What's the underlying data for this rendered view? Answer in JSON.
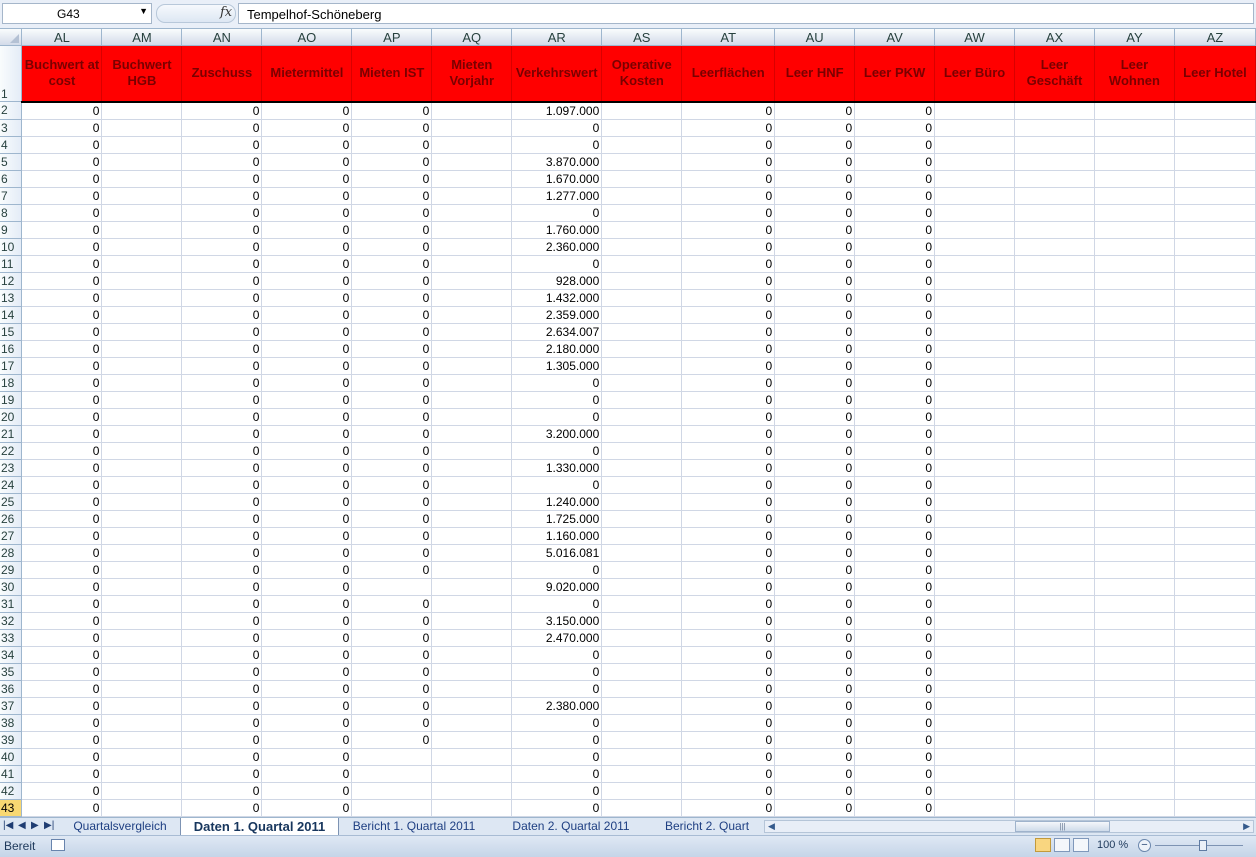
{
  "formula_bar": {
    "name_box": "G43",
    "fx_icon": "function-icon",
    "formula": "Tempelhof-Schöneberg"
  },
  "columns": [
    "AL",
    "AM",
    "AN",
    "AO",
    "AP",
    "AQ",
    "AR",
    "AS",
    "AT",
    "AU",
    "AV",
    "AW",
    "AX",
    "AY",
    "AZ"
  ],
  "header_row_num": "1",
  "headers": [
    "Buchwert at cost",
    "Buchwert HGB",
    "Zuschuss",
    "Mietermittel",
    "Mieten IST",
    "Mieten Vorjahr",
    "Verkehrswert",
    "Operative Kosten",
    "Leerflächen",
    "Leer HNF",
    "Leer PKW",
    "Leer Büro",
    "Leer Geschäft",
    "Leer Wohnen",
    "Leer Hotel"
  ],
  "rows": [
    {
      "n": "2",
      "v": [
        "0",
        "",
        "0",
        "0",
        "0",
        "",
        "1.097.000",
        "",
        "0",
        "0",
        "0",
        "",
        "",
        "",
        ""
      ]
    },
    {
      "n": "3",
      "v": [
        "0",
        "",
        "0",
        "0",
        "0",
        "",
        "0",
        "",
        "0",
        "0",
        "0",
        "",
        "",
        "",
        ""
      ]
    },
    {
      "n": "4",
      "v": [
        "0",
        "",
        "0",
        "0",
        "0",
        "",
        "0",
        "",
        "0",
        "0",
        "0",
        "",
        "",
        "",
        ""
      ]
    },
    {
      "n": "5",
      "v": [
        "0",
        "",
        "0",
        "0",
        "0",
        "",
        "3.870.000",
        "",
        "0",
        "0",
        "0",
        "",
        "",
        "",
        ""
      ]
    },
    {
      "n": "6",
      "v": [
        "0",
        "",
        "0",
        "0",
        "0",
        "",
        "1.670.000",
        "",
        "0",
        "0",
        "0",
        "",
        "",
        "",
        ""
      ]
    },
    {
      "n": "7",
      "v": [
        "0",
        "",
        "0",
        "0",
        "0",
        "",
        "1.277.000",
        "",
        "0",
        "0",
        "0",
        "",
        "",
        "",
        ""
      ]
    },
    {
      "n": "8",
      "v": [
        "0",
        "",
        "0",
        "0",
        "0",
        "",
        "0",
        "",
        "0",
        "0",
        "0",
        "",
        "",
        "",
        ""
      ]
    },
    {
      "n": "9",
      "v": [
        "0",
        "",
        "0",
        "0",
        "0",
        "",
        "1.760.000",
        "",
        "0",
        "0",
        "0",
        "",
        "",
        "",
        ""
      ]
    },
    {
      "n": "10",
      "v": [
        "0",
        "",
        "0",
        "0",
        "0",
        "",
        "2.360.000",
        "",
        "0",
        "0",
        "0",
        "",
        "",
        "",
        ""
      ]
    },
    {
      "n": "11",
      "v": [
        "0",
        "",
        "0",
        "0",
        "0",
        "",
        "0",
        "",
        "0",
        "0",
        "0",
        "",
        "",
        "",
        ""
      ]
    },
    {
      "n": "12",
      "v": [
        "0",
        "",
        "0",
        "0",
        "0",
        "",
        "928.000",
        "",
        "0",
        "0",
        "0",
        "",
        "",
        "",
        ""
      ]
    },
    {
      "n": "13",
      "v": [
        "0",
        "",
        "0",
        "0",
        "0",
        "",
        "1.432.000",
        "",
        "0",
        "0",
        "0",
        "",
        "",
        "",
        ""
      ]
    },
    {
      "n": "14",
      "v": [
        "0",
        "",
        "0",
        "0",
        "0",
        "",
        "2.359.000",
        "",
        "0",
        "0",
        "0",
        "",
        "",
        "",
        ""
      ]
    },
    {
      "n": "15",
      "v": [
        "0",
        "",
        "0",
        "0",
        "0",
        "",
        "2.634.007",
        "",
        "0",
        "0",
        "0",
        "",
        "",
        "",
        ""
      ]
    },
    {
      "n": "16",
      "v": [
        "0",
        "",
        "0",
        "0",
        "0",
        "",
        "2.180.000",
        "",
        "0",
        "0",
        "0",
        "",
        "",
        "",
        ""
      ]
    },
    {
      "n": "17",
      "v": [
        "0",
        "",
        "0",
        "0",
        "0",
        "",
        "1.305.000",
        "",
        "0",
        "0",
        "0",
        "",
        "",
        "",
        ""
      ]
    },
    {
      "n": "18",
      "v": [
        "0",
        "",
        "0",
        "0",
        "0",
        "",
        "0",
        "",
        "0",
        "0",
        "0",
        "",
        "",
        "",
        ""
      ]
    },
    {
      "n": "19",
      "v": [
        "0",
        "",
        "0",
        "0",
        "0",
        "",
        "0",
        "",
        "0",
        "0",
        "0",
        "",
        "",
        "",
        ""
      ]
    },
    {
      "n": "20",
      "v": [
        "0",
        "",
        "0",
        "0",
        "0",
        "",
        "0",
        "",
        "0",
        "0",
        "0",
        "",
        "",
        "",
        ""
      ]
    },
    {
      "n": "21",
      "v": [
        "0",
        "",
        "0",
        "0",
        "0",
        "",
        "3.200.000",
        "",
        "0",
        "0",
        "0",
        "",
        "",
        "",
        ""
      ]
    },
    {
      "n": "22",
      "v": [
        "0",
        "",
        "0",
        "0",
        "0",
        "",
        "0",
        "",
        "0",
        "0",
        "0",
        "",
        "",
        "",
        ""
      ]
    },
    {
      "n": "23",
      "v": [
        "0",
        "",
        "0",
        "0",
        "0",
        "",
        "1.330.000",
        "",
        "0",
        "0",
        "0",
        "",
        "",
        "",
        ""
      ]
    },
    {
      "n": "24",
      "v": [
        "0",
        "",
        "0",
        "0",
        "0",
        "",
        "0",
        "",
        "0",
        "0",
        "0",
        "",
        "",
        "",
        ""
      ]
    },
    {
      "n": "25",
      "v": [
        "0",
        "",
        "0",
        "0",
        "0",
        "",
        "1.240.000",
        "",
        "0",
        "0",
        "0",
        "",
        "",
        "",
        ""
      ]
    },
    {
      "n": "26",
      "v": [
        "0",
        "",
        "0",
        "0",
        "0",
        "",
        "1.725.000",
        "",
        "0",
        "0",
        "0",
        "",
        "",
        "",
        ""
      ]
    },
    {
      "n": "27",
      "v": [
        "0",
        "",
        "0",
        "0",
        "0",
        "",
        "1.160.000",
        "",
        "0",
        "0",
        "0",
        "",
        "",
        "",
        ""
      ]
    },
    {
      "n": "28",
      "v": [
        "0",
        "",
        "0",
        "0",
        "0",
        "",
        "5.016.081",
        "",
        "0",
        "0",
        "0",
        "",
        "",
        "",
        ""
      ]
    },
    {
      "n": "29",
      "v": [
        "0",
        "",
        "0",
        "0",
        "0",
        "",
        "0",
        "",
        "0",
        "0",
        "0",
        "",
        "",
        "",
        ""
      ]
    },
    {
      "n": "30",
      "v": [
        "0",
        "",
        "0",
        "0",
        "",
        "",
        "9.020.000",
        "",
        "0",
        "0",
        "0",
        "",
        "",
        "",
        ""
      ]
    },
    {
      "n": "31",
      "v": [
        "0",
        "",
        "0",
        "0",
        "0",
        "",
        "0",
        "",
        "0",
        "0",
        "0",
        "",
        "",
        "",
        ""
      ]
    },
    {
      "n": "32",
      "v": [
        "0",
        "",
        "0",
        "0",
        "0",
        "",
        "3.150.000",
        "",
        "0",
        "0",
        "0",
        "",
        "",
        "",
        ""
      ]
    },
    {
      "n": "33",
      "v": [
        "0",
        "",
        "0",
        "0",
        "0",
        "",
        "2.470.000",
        "",
        "0",
        "0",
        "0",
        "",
        "",
        "",
        ""
      ]
    },
    {
      "n": "34",
      "v": [
        "0",
        "",
        "0",
        "0",
        "0",
        "",
        "0",
        "",
        "0",
        "0",
        "0",
        "",
        "",
        "",
        ""
      ]
    },
    {
      "n": "35",
      "v": [
        "0",
        "",
        "0",
        "0",
        "0",
        "",
        "0",
        "",
        "0",
        "0",
        "0",
        "",
        "",
        "",
        ""
      ]
    },
    {
      "n": "36",
      "v": [
        "0",
        "",
        "0",
        "0",
        "0",
        "",
        "0",
        "",
        "0",
        "0",
        "0",
        "",
        "",
        "",
        ""
      ]
    },
    {
      "n": "37",
      "v": [
        "0",
        "",
        "0",
        "0",
        "0",
        "",
        "2.380.000",
        "",
        "0",
        "0",
        "0",
        "",
        "",
        "",
        ""
      ]
    },
    {
      "n": "38",
      "v": [
        "0",
        "",
        "0",
        "0",
        "0",
        "",
        "0",
        "",
        "0",
        "0",
        "0",
        "",
        "",
        "",
        ""
      ]
    },
    {
      "n": "39",
      "v": [
        "0",
        "",
        "0",
        "0",
        "0",
        "",
        "0",
        "",
        "0",
        "0",
        "0",
        "",
        "",
        "",
        ""
      ]
    },
    {
      "n": "40",
      "v": [
        "0",
        "",
        "0",
        "0",
        "",
        "",
        "0",
        "",
        "0",
        "0",
        "0",
        "",
        "",
        "",
        ""
      ]
    },
    {
      "n": "41",
      "v": [
        "0",
        "",
        "0",
        "0",
        "",
        "",
        "0",
        "",
        "0",
        "0",
        "0",
        "",
        "",
        "",
        ""
      ]
    },
    {
      "n": "42",
      "v": [
        "0",
        "",
        "0",
        "0",
        "",
        "",
        "0",
        "",
        "0",
        "0",
        "0",
        "",
        "",
        "",
        ""
      ]
    },
    {
      "n": "43",
      "v": [
        "0",
        "",
        "0",
        "0",
        "",
        "",
        "0",
        "",
        "0",
        "0",
        "0",
        "",
        "",
        "",
        ""
      ]
    }
  ],
  "selected_row": "43",
  "sheet_tabs": [
    {
      "label": "Quartalsvergleich",
      "active": false
    },
    {
      "label": "Daten 1. Quartal 2011",
      "active": true
    },
    {
      "label": "Bericht 1. Quartal 2011",
      "active": false
    },
    {
      "label": "Daten 2. Quartal 2011",
      "active": false
    },
    {
      "label": "Bericht 2. Quart",
      "active": false
    }
  ],
  "status_bar": {
    "ready": "Bereit",
    "zoom": "100 %",
    "zoom_minus": "−"
  },
  "colors": {
    "header_fill": "#ff0000",
    "header_text": "#7a0000",
    "selected_row_header": "#f8d872"
  }
}
